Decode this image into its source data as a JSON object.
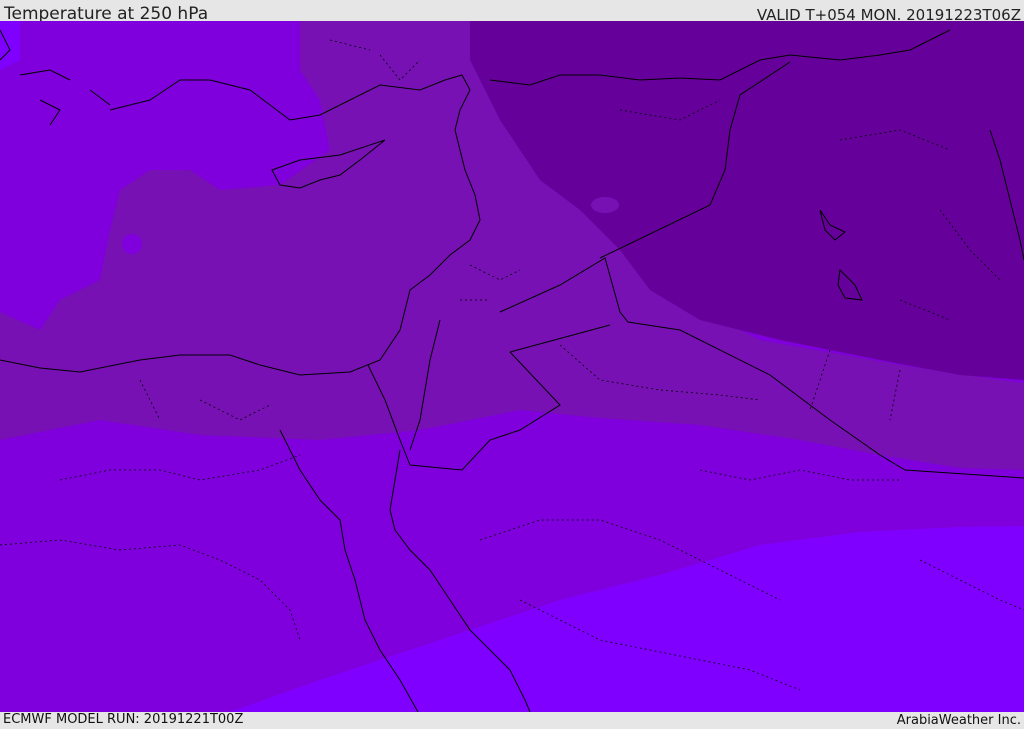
{
  "header": {
    "title": "Temperature at 250 hPa",
    "valid": "VALID T+054 MON. 20191223T06Z"
  },
  "footer": {
    "model_run": "ECMWF MODEL RUN: 20191221T00Z",
    "credit": "ArabiaWeather Inc."
  },
  "map": {
    "colors": {
      "darkest": "#66009a",
      "dark": "#7711b4",
      "mid": "#7f00dc",
      "light": "#8000ff",
      "border": "#000000"
    }
  }
}
